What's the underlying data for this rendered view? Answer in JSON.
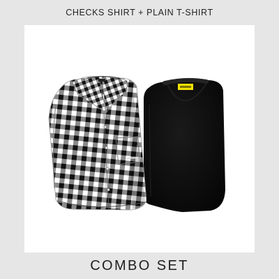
{
  "header": {
    "title": "CHECKS SHIRT + PLAIN T-SHIRT"
  },
  "products": [
    {
      "name": "checks-shirt",
      "pattern": "gingham",
      "colors": [
        "#1a1a1a",
        "#ffffff"
      ]
    },
    {
      "name": "plain-tshirt",
      "color": "#0c0c0c",
      "tag_color": "#f2e200"
    }
  ],
  "footer": {
    "label": "COMBO SET"
  },
  "colors": {
    "background": "#e6e6e6",
    "card": "#ffffff",
    "text": "#1e1e1e"
  }
}
